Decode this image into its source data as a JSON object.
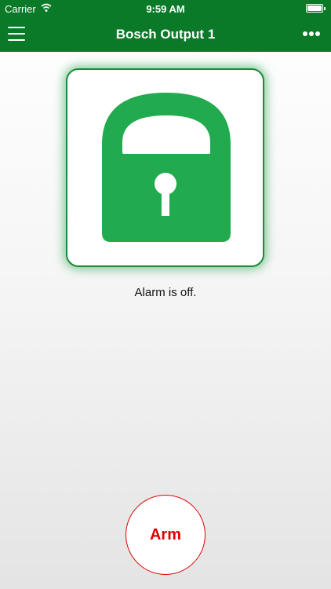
{
  "status_bar": {
    "carrier": "Carrier",
    "time": "9:59 AM",
    "wifi_icon": "wifi-icon",
    "battery_icon": "battery-icon"
  },
  "nav": {
    "title": "Bosch Output 1",
    "menu_icon": "hamburger-menu-icon",
    "more_icon": "more-dots-icon"
  },
  "lock": {
    "icon": "padlock-icon",
    "color": "#22ab4e",
    "state": "unlocked"
  },
  "status_message": "Alarm is off.",
  "action": {
    "label": "Arm",
    "color": "#e00000"
  },
  "colors": {
    "brand": "#0a7a28",
    "lock_green": "#22ab4e",
    "action_red": "#e00000"
  }
}
